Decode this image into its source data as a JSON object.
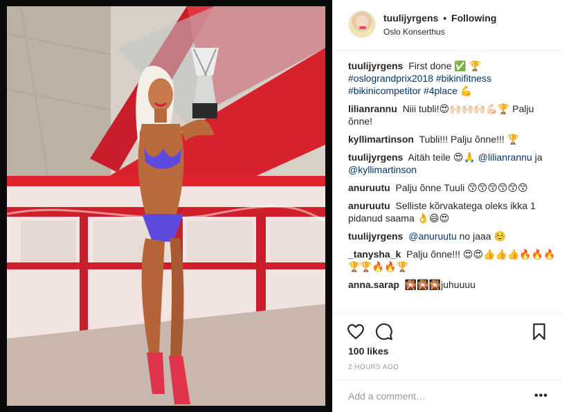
{
  "post": {
    "username": "tuulijyrgens",
    "follow_status": "Following",
    "location": "Oslo Konserthus",
    "likes": "100 likes",
    "time": "2 HOURS AGO",
    "comment_placeholder": "Add a comment…",
    "more_glyph": "•••"
  },
  "caption": {
    "author": "tuulijyrgens",
    "text": "First done ✅ 🏆",
    "hashtags": [
      "#oslograndprix2018",
      "#bikinifitness",
      "#bikinicompetitor",
      "#4place"
    ],
    "suffix": "💪"
  },
  "comments": [
    {
      "author": "lilianrannu",
      "text": "Niii tubli!😍🙌🏻🙌🏻🙌🏻💪🏻🏆 Palju õnne!"
    },
    {
      "author": "kyllimartinson",
      "text": "Tubli!!! Palju õnne!!! 🏆"
    },
    {
      "author": "tuulijyrgens",
      "text": "Aitäh teile 😍🙏",
      "mention1": "@lilianrannu",
      "mid": "ja",
      "mention2": "@kyllimartinson"
    },
    {
      "author": "anuruutu",
      "text": "Palju õnne Tuuli 😙😙😙😙😙😙"
    },
    {
      "author": "anuruutu",
      "text": "Selliste kõrvakategа oleks ikka 1 pidanud saama 👌😄😍"
    },
    {
      "author": "tuulijyrgens",
      "mention": "@anuruutu",
      "text": "no jaaa ☺️"
    },
    {
      "author": "_tanysha_k",
      "text": "Palju õnne!!! 😍😍👍👍👍🔥🔥🔥🏆🏆🔥🔥🏆"
    },
    {
      "author": "anna.sarap",
      "text": "🎇🎇🎇juhuuuu"
    }
  ],
  "icons": {
    "like": "heart-icon",
    "comment": "comment-icon",
    "save": "bookmark-icon"
  },
  "colors": {
    "hashtag": "#003569",
    "muted": "#999999",
    "text": "#262626"
  }
}
